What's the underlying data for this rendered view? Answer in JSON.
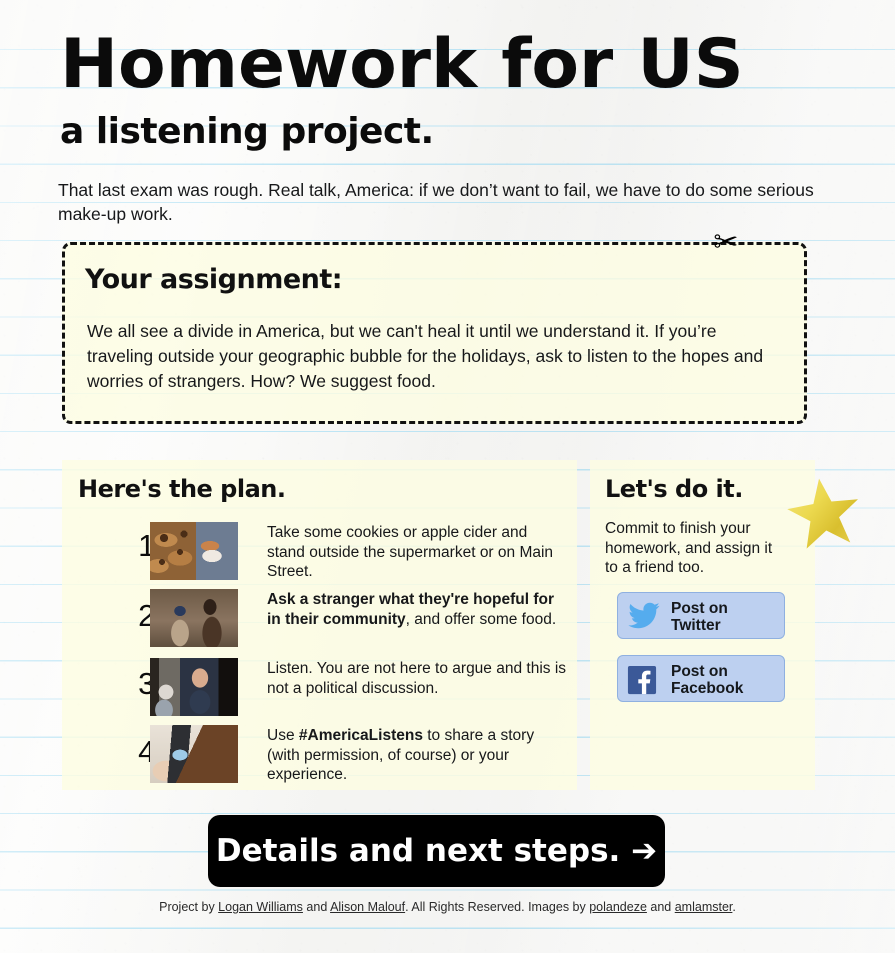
{
  "header": {
    "title": "Homework for US",
    "subtitle": "a listening project.",
    "intro": "That last exam was rough. Real talk, America: if we don’t want to fail, we have to do some serious make-up work."
  },
  "assignment": {
    "heading": "Your assignment:",
    "body": "We all see a divide in America, but we can't heal it until we understand it. If you’re traveling outside your geographic bubble for the holidays, ask to listen to the hopes and worries of strangers. How? We suggest food.",
    "cut_icon": "scissors-icon"
  },
  "plan": {
    "heading": "Here's the plan.",
    "steps": [
      {
        "number": "1.",
        "image": "cookies-and-cider-photo",
        "text_plain": "Take some cookies or apple cider and stand outside the supermarket or on Main Street.",
        "bold": "",
        "rest": "Take some cookies or apple cider and stand outside the supermarket or on Main Street."
      },
      {
        "number": "2.",
        "image": "two-people-talking-photo",
        "text_plain": "Ask a stranger what they're hopeful for in their community, and offer some food.",
        "bold": "Ask a stranger what they're hopeful for in their community",
        "rest": ", and offer some food."
      },
      {
        "number": "3.",
        "image": "man-listening-photo",
        "text_plain": "Listen. You are not here to argue and this is not a political discussion.",
        "bold": "",
        "rest": "Listen. You are not here to argue and this is not a political discussion."
      },
      {
        "number": "4.",
        "image": "woman-with-phone-photo",
        "text_plain": "Use #AmericaListens to share a story (with permission, of course) or your experience.",
        "bold_lead": "Use ",
        "bold": "#AmericaListens",
        "rest": " to share a story (with permission, of course) or your experience."
      }
    ]
  },
  "commit": {
    "heading": "Let's do it.",
    "body": "Commit to finish your homework, and assign it to a friend too.",
    "buttons": [
      {
        "label_line1": "Post on",
        "label_line2": "Twitter",
        "icon": "twitter-bird-icon",
        "color": "#55acee"
      },
      {
        "label_line1": "Post on",
        "label_line2": "Facebook",
        "icon": "facebook-f-icon",
        "color": "#3b5998"
      }
    ],
    "sticker": "gold-star-sticker"
  },
  "cta": {
    "label": "Details and next steps. ➔"
  },
  "footer": {
    "part1": "Project by ",
    "link1": "Logan Williams",
    "part2": " and ",
    "link2": "Alison Malouf",
    "part3": ". All Rights Reserved. Images by ",
    "link3": "polandeze",
    "part4": " and ",
    "link4": "amlamster",
    "part5": "."
  },
  "colors": {
    "paper": "#fafafa",
    "rule_line": "#bfe6f5",
    "cream_panel": "#fcfce2",
    "social_button": "#bdd0f0",
    "social_button_border": "#8fb0e0",
    "twitter_blue": "#55acee",
    "facebook_blue": "#3b5998",
    "star_gold": "#e8cf45",
    "cta_background": "#000000"
  }
}
